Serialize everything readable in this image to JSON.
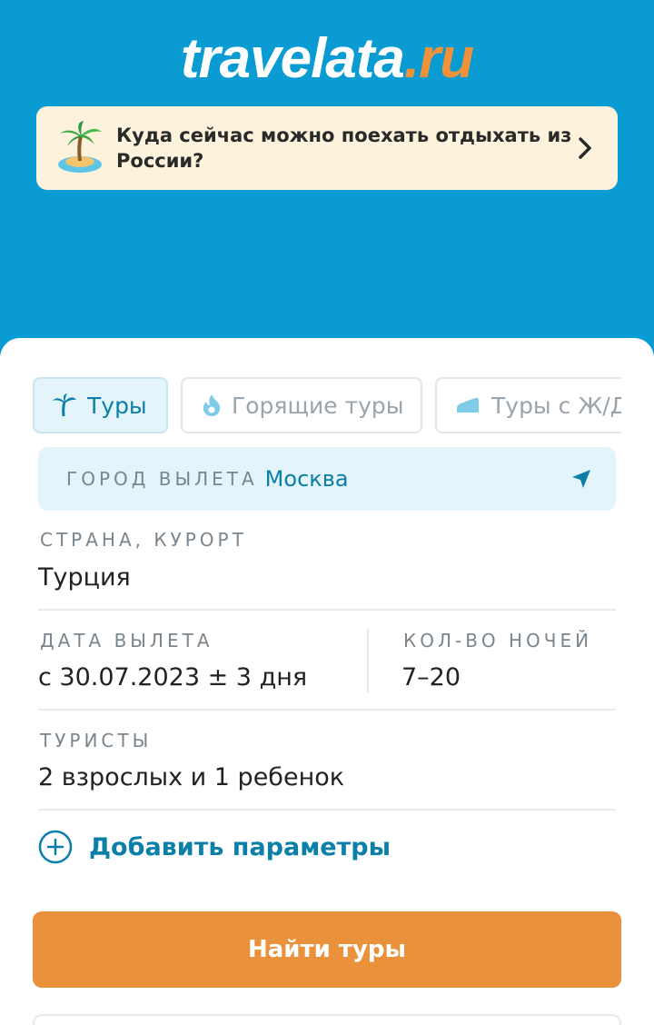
{
  "brand": {
    "logo_main": "travelata",
    "logo_tld": ".ru"
  },
  "banner": {
    "text": "Куда сейчас можно поехать отдыхать из России?",
    "icon": "palm-island-icon"
  },
  "tabs": [
    {
      "label": "Туры",
      "icon": "palm-icon",
      "active": true
    },
    {
      "label": "Горящие туры",
      "icon": "flame-icon",
      "active": false
    },
    {
      "label": "Туры с Ж/Д",
      "icon": "train-icon",
      "active": false
    }
  ],
  "departure": {
    "label": "ГОРОД ВЫЛЕТА",
    "value": "Москва"
  },
  "destination": {
    "label": "СТРАНА, КУРОРТ",
    "value": "Турция"
  },
  "date": {
    "label": "ДАТА ВЫЛЕТА",
    "value": "с 30.07.2023 ± 3 дня"
  },
  "nights": {
    "label": "КОЛ-ВО НОЧЕЙ",
    "value": "7–20"
  },
  "tourists": {
    "label": "ТУРИСТЫ",
    "value": "2 взрослых и 1 ребенок"
  },
  "add_params": {
    "label": "Добавить параметры"
  },
  "search_button": {
    "label": "Найти туры"
  },
  "colors": {
    "header": "#0a9bd2",
    "accent": "#0b7fa8",
    "button": "#e9923b",
    "logo_tld": "#f0923a"
  }
}
